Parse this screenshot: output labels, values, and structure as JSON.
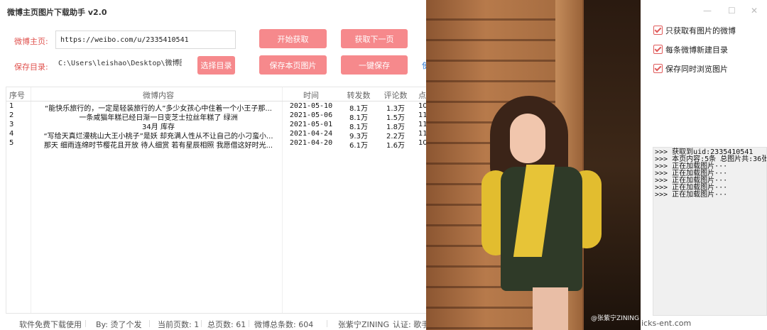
{
  "app": {
    "title": "微博主页图片下载助手 v2.0",
    "window_controls": [
      "—",
      "☐",
      "✕"
    ]
  },
  "form": {
    "homepage_label": "微博主页:",
    "homepage_url": "https://weibo.com/u/2335410541",
    "save_dir_label": "保存目录:",
    "save_dir_value": "C:\\Users\\leishao\\Desktop\\微博图下载",
    "choose_dir_button": "选择目录"
  },
  "actions": {
    "start_fetch": "开始获取",
    "fetch_next_page": "获取下一页",
    "save_page_images": "保存本页图片",
    "one_click_save": "一键保存",
    "partial_link": "使"
  },
  "table": {
    "columns": [
      "序号",
      "微博内容",
      "时间",
      "转发数",
      "评论数",
      "点"
    ],
    "rows": [
      {
        "idx": "1",
        "content": "“能快乐旅行的，一定是轻装旅行的人”多少女孩心中住着一个小王子那...",
        "time": "2021-05-10",
        "forwards": "8.1万",
        "comments": "1.3万",
        "likes": "10"
      },
      {
        "idx": "2",
        "content": "一条咸猫年糕已经日渐一日变芝士拉丝年糕了 绿洲",
        "time": "2021-05-06",
        "forwards": "8.1万",
        "comments": "1.5万",
        "likes": "11"
      },
      {
        "idx": "3",
        "content": "34月 库存",
        "time": "2021-05-01",
        "forwards": "8.1万",
        "comments": "1.8万",
        "likes": "11"
      },
      {
        "idx": "4",
        "content": "“写给天真烂漫桃山大王小桃子”是妖 却充满人性从不让自己的小刁蛮小...",
        "time": "2021-04-24",
        "forwards": "9.3万",
        "comments": "2.2万",
        "likes": "11"
      },
      {
        "idx": "5",
        "content": "那天 细雨连绵时节樱花且开放 待人细赏 若有星辰相照 我愿借这好时光...",
        "time": "2021-04-20",
        "forwards": "6.1万",
        "comments": "1.6万",
        "likes": "10"
      }
    ]
  },
  "options": [
    {
      "label": "只获取有图片的微博",
      "checked": true
    },
    {
      "label": "每条微博新建目录",
      "checked": true
    },
    {
      "label": "保存同时浏览图片",
      "checked": true
    }
  ],
  "log": [
    ">>> 获取到uid:2335410541",
    ">>> 本页内容:5条 总图片共:36张",
    ">>> 正在加载图片···",
    ">>> 正在加载图片···",
    ">>> 正在加载图片···",
    ">>> 正在加载图片···",
    ">>> 正在加载图片···"
  ],
  "preview": {
    "watermark": "@张紫宁ZINING"
  },
  "status_bar": {
    "free_notice": "软件免费下载使用",
    "author": "By: 烫了个发",
    "current_page": "当前页数: 1",
    "total_pages": "总页数: 61",
    "total_weibo": "微博总条数: 604",
    "user_name": "张紫宁ZINING",
    "auth_fragment": "认证: 歌手",
    "right_fragment": "icks-ent.com"
  },
  "colors": {
    "accent_button": "#f6898c",
    "label_red": "#e0534f",
    "checkbox": "#e05c5c"
  }
}
